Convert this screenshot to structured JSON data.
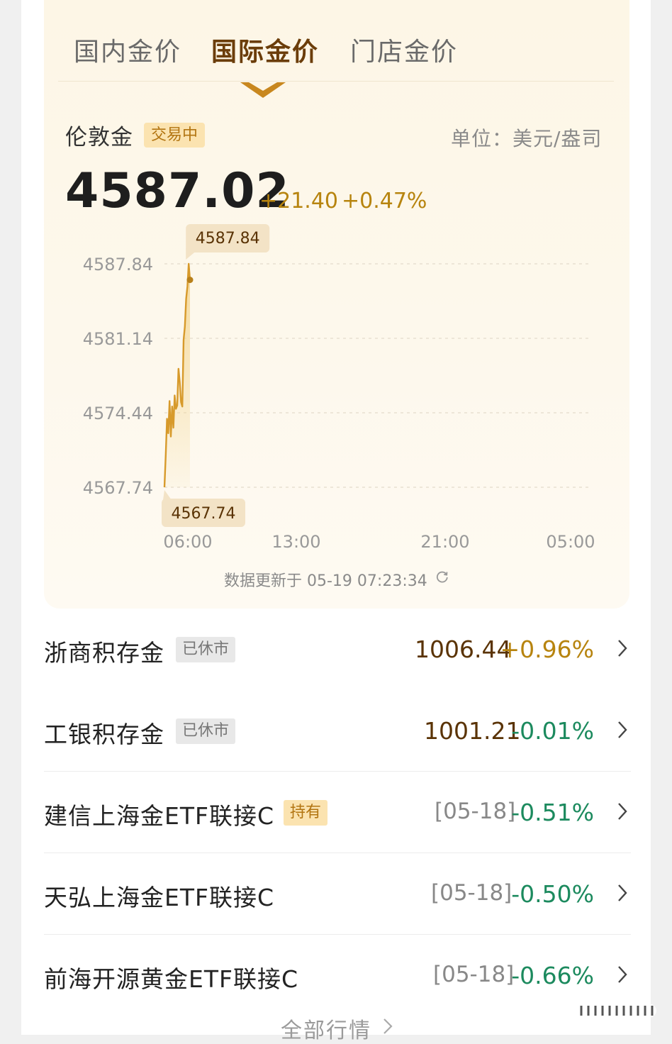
{
  "tabs": [
    {
      "label": "国内金价",
      "active": false
    },
    {
      "label": "国际金价",
      "active": true
    },
    {
      "label": "门店金价",
      "active": false
    }
  ],
  "quote": {
    "name": "伦敦金",
    "status_badge": "交易中",
    "unit": "单位：美元/盎司",
    "price": "4587.02",
    "change": "+21.40",
    "change_pct": "+0.47%"
  },
  "chart_data": {
    "type": "line",
    "title": "",
    "xlabel": "",
    "ylabel": "",
    "y_ticks": [
      "4587.84",
      "4581.14",
      "4574.44",
      "4567.74"
    ],
    "x_ticks": [
      "06:00",
      "13:00",
      "21:00",
      "05:00"
    ],
    "ylim": [
      4567.74,
      4587.84
    ],
    "grid": true,
    "high_label": "4587.84",
    "low_label": "4567.74",
    "series": [
      {
        "values": [
          4567.74,
          4570.6,
          4573.9,
          4572.6,
          4575.5,
          4572.3,
          4575.0,
          4573.1,
          4576.0,
          4574.8,
          4575.1,
          4578.4,
          4577.2,
          4575.4,
          4575.0,
          4581.0,
          4582.2,
          4584.7,
          4585.8,
          4587.84,
          4586.4
        ]
      }
    ],
    "colors": {
      "line": "#d79a2b",
      "fill_top": "#f3d48d",
      "grid": "#e4dccb",
      "marker": "#b8801a"
    }
  },
  "update_time": "数据更新于 05-19 07:23:34",
  "list": [
    {
      "name": "浙商积存金",
      "tag": "已休市",
      "tag_type": "closed",
      "value": "1006.44",
      "pct": "+0.96%",
      "dir": "up"
    },
    {
      "name": "工银积存金",
      "tag": "已休市",
      "tag_type": "closed",
      "value": "1001.21",
      "pct": "-0.01%",
      "dir": "down"
    },
    {
      "name": "建信上海金ETF联接C",
      "tag": "持有",
      "tag_type": "hold",
      "date": "[05-18]",
      "pct": "-0.51%",
      "dir": "down"
    },
    {
      "name": "天弘上海金ETF联接C",
      "date": "[05-18]",
      "pct": "-0.50%",
      "dir": "down"
    },
    {
      "name": "前海开源黄金ETF联接C",
      "date": "[05-18]",
      "pct": "-0.66%",
      "dir": "down"
    }
  ],
  "all_market": "全部行情"
}
